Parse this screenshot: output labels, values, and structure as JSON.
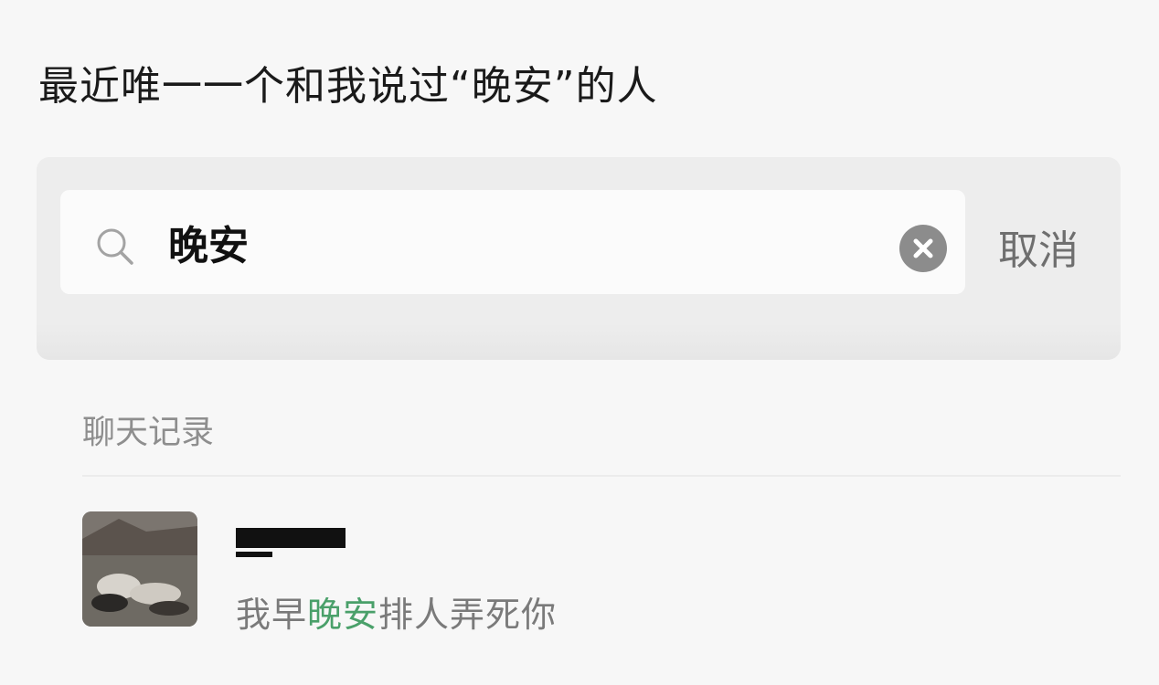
{
  "caption": "最近唯一一个和我说过“晚安”的人",
  "search": {
    "query": "晚安",
    "cancel_label": "取消",
    "search_icon": "search-icon",
    "clear_icon": "clear-icon"
  },
  "results": {
    "section_label": "聊天记录",
    "items": [
      {
        "name": "",
        "snippet_before": "我早",
        "snippet_match": "晚安",
        "snippet_after": "排人弄死你"
      }
    ]
  },
  "colors": {
    "highlight": "#4aa06a",
    "panel_bg": "#ededed",
    "box_bg": "#fbfbfb"
  }
}
